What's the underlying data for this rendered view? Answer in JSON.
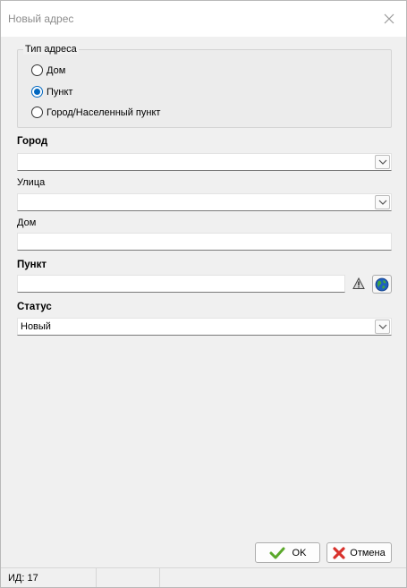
{
  "window": {
    "title": "Новый адрес"
  },
  "address_type": {
    "legend": "Тип адреса",
    "options": [
      {
        "label": "Дом",
        "checked": false
      },
      {
        "label": "Пункт",
        "checked": true
      },
      {
        "label": "Город/Населенный пункт",
        "checked": false
      }
    ]
  },
  "fields": {
    "city": {
      "label": "Город",
      "value": ""
    },
    "street": {
      "label": "Улица",
      "value": ""
    },
    "house": {
      "label": "Дом",
      "value": ""
    },
    "point": {
      "label": "Пункт",
      "value": ""
    },
    "status": {
      "label": "Статус",
      "value": "Новый"
    }
  },
  "buttons": {
    "ok": "OK",
    "cancel": "Отмена"
  },
  "statusbar": {
    "id_text": "ИД: 17"
  },
  "colors": {
    "accent": "#0067c0",
    "ok_check": "#5aa82a",
    "cancel_x": "#d8312b"
  },
  "icons": [
    "close-icon",
    "chevron-down-icon",
    "warning-icon",
    "globe-icon",
    "checkmark-icon",
    "red-x-icon"
  ]
}
